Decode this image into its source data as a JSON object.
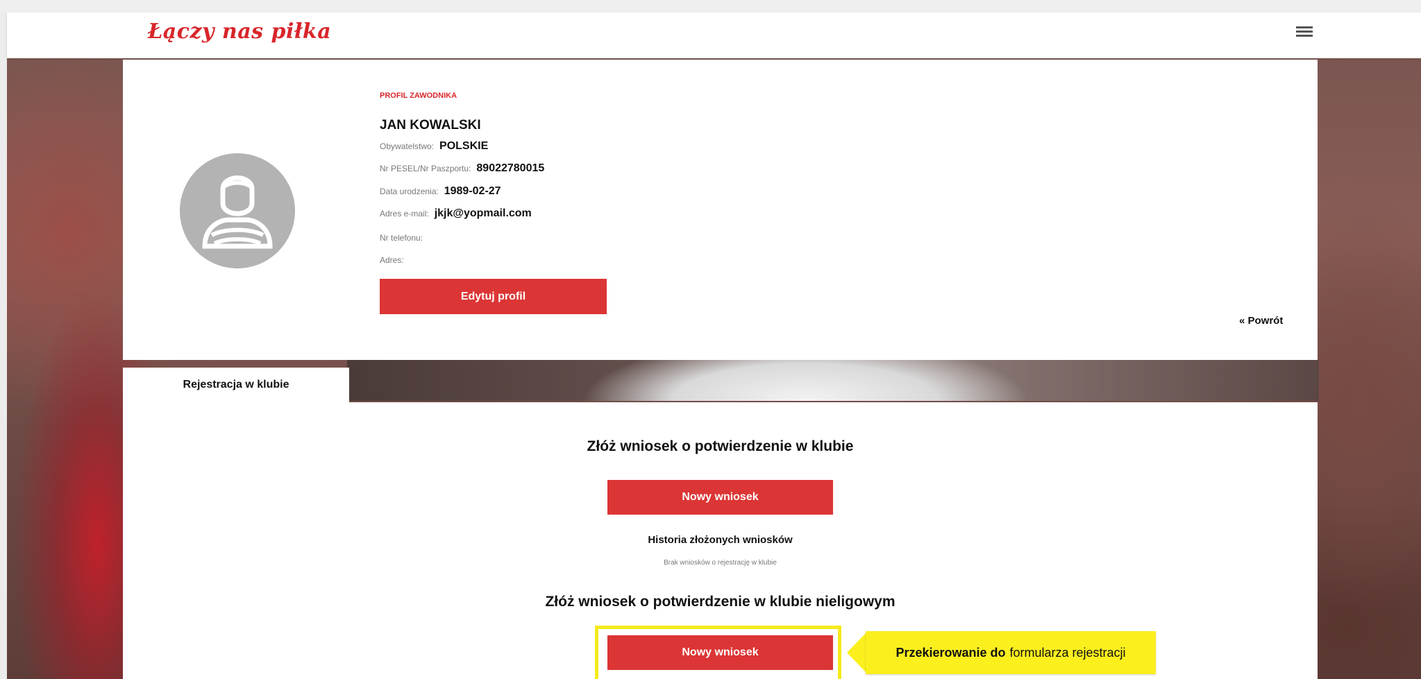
{
  "header": {
    "logo_text": "Łączy nas piłka",
    "menu_icon": "hamburger-menu-icon"
  },
  "profile": {
    "section_label": "PROFIL ZAWODNIKA",
    "name": "JAN KOWALSKI",
    "fields": [
      {
        "label": "Obywatelstwo:",
        "value": "POLSKIE"
      },
      {
        "label": "Nr PESEL/Nr Paszportu:",
        "value": "89022780015"
      },
      {
        "label": "Data urodzenia:",
        "value": "1989-02-27"
      },
      {
        "label": "Adres e-mail:",
        "value": "jkjk@yopmail.com"
      },
      {
        "label": "Nr telefonu:",
        "value": ""
      },
      {
        "label": "Adres:",
        "value": ""
      }
    ],
    "edit_button": "Edytuj profil",
    "back_link": "« Powrót",
    "avatar_icon": "user-avatar-icon"
  },
  "tabs": [
    {
      "label": "Rejestracja w klubie",
      "active": true
    }
  ],
  "registration": {
    "title_club": "Złóż wniosek o potwierdzenie w klubie",
    "new_request_button_1": "Nowy wniosek",
    "history_title": "Historia złożonych wniosków",
    "history_empty": "Brak wniosków o rejestrację w klubie",
    "title_nonleague": "Złóż wniosek o potwierdzenie w klubie nieligowym",
    "new_request_button_2": "Nowy wniosek"
  },
  "callout": {
    "bold_text": "Przekierowanie do",
    "text": "formularza rejestracji"
  },
  "colors": {
    "brand_red": "#dc3535",
    "logo_red": "#d8262b",
    "highlight_yellow": "#fbef1e"
  }
}
